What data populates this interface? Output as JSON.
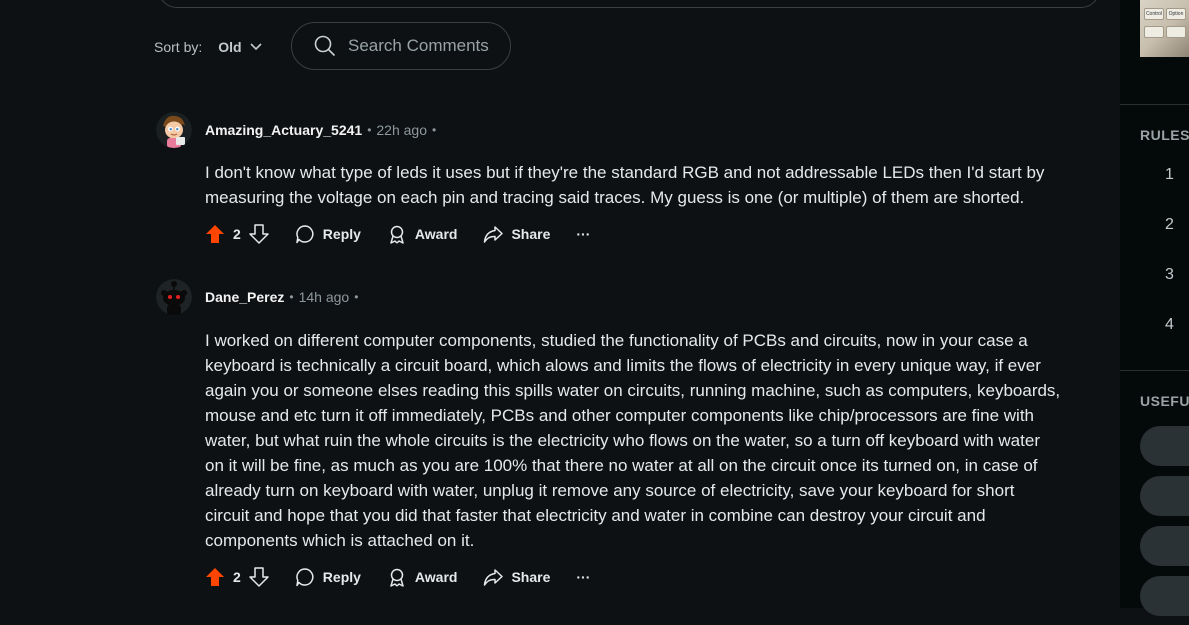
{
  "sort": {
    "label": "Sort by:",
    "selected": "Old"
  },
  "search": {
    "placeholder": "Search Comments"
  },
  "comments": [
    {
      "author": "Amazing_Actuary_5241",
      "time": "22h ago",
      "body": "I don't know what type of leds it uses but if they're the standard RGB and not addressable LEDs then I'd start by\nmeasuring the voltage on each pin and tracing said traces. My guess is one (or multiple) of them are shorted.",
      "votes": "2",
      "reply_label": "Reply",
      "award_label": "Award",
      "share_label": "Share",
      "more_label": "···"
    },
    {
      "author": "Dane_Perez",
      "time": "14h ago",
      "body": "I worked on different computer components, studied the functionality of PCBs and circuits, now in your case a\nkeyboard is technically a circuit board, which alows and limits the flows of electricity in every unique way, if ever\nagain you or someone elses reading this spills water on circuits, running machine, such as computers, keyboards,\nmouse and etc turn it off immediately, PCBs and other computer components like chip/processors are fine with\nwater, but what ruin the whole circuits is the electricity who flows on the water, so a turn off keyboard with water\non it will be fine, as much as you are 100% that there no water at all on the circuit once its turned on, in case of\nalready turn on keyboard with water, unplug it remove any source of electricity, save your keyboard for short\ncircuit and hope that you did that faster that electricity and water in combine can destroy your circuit and\ncomponents which is attached on it.",
      "votes": "2",
      "reply_label": "Reply",
      "award_label": "Award",
      "share_label": "Share",
      "more_label": "···"
    }
  ],
  "sidebar": {
    "thumb_keys": [
      "Control",
      "Option"
    ],
    "rules_title": "RULES",
    "rule_numbers": [
      "1",
      "2",
      "3",
      "4"
    ],
    "useful_title": "USEFUL"
  },
  "colors": {
    "background": "#0e1113",
    "upvote_active": "#ff4500",
    "text_muted": "#8e989c",
    "sidebar_bg": "#04090a"
  },
  "icons": {
    "search": "search-icon",
    "chevron": "chevron-down-icon",
    "upvote": "upvote-icon",
    "downvote": "downvote-icon",
    "reply": "comment-icon",
    "award": "award-icon",
    "share": "share-icon",
    "more": "more-icon"
  }
}
